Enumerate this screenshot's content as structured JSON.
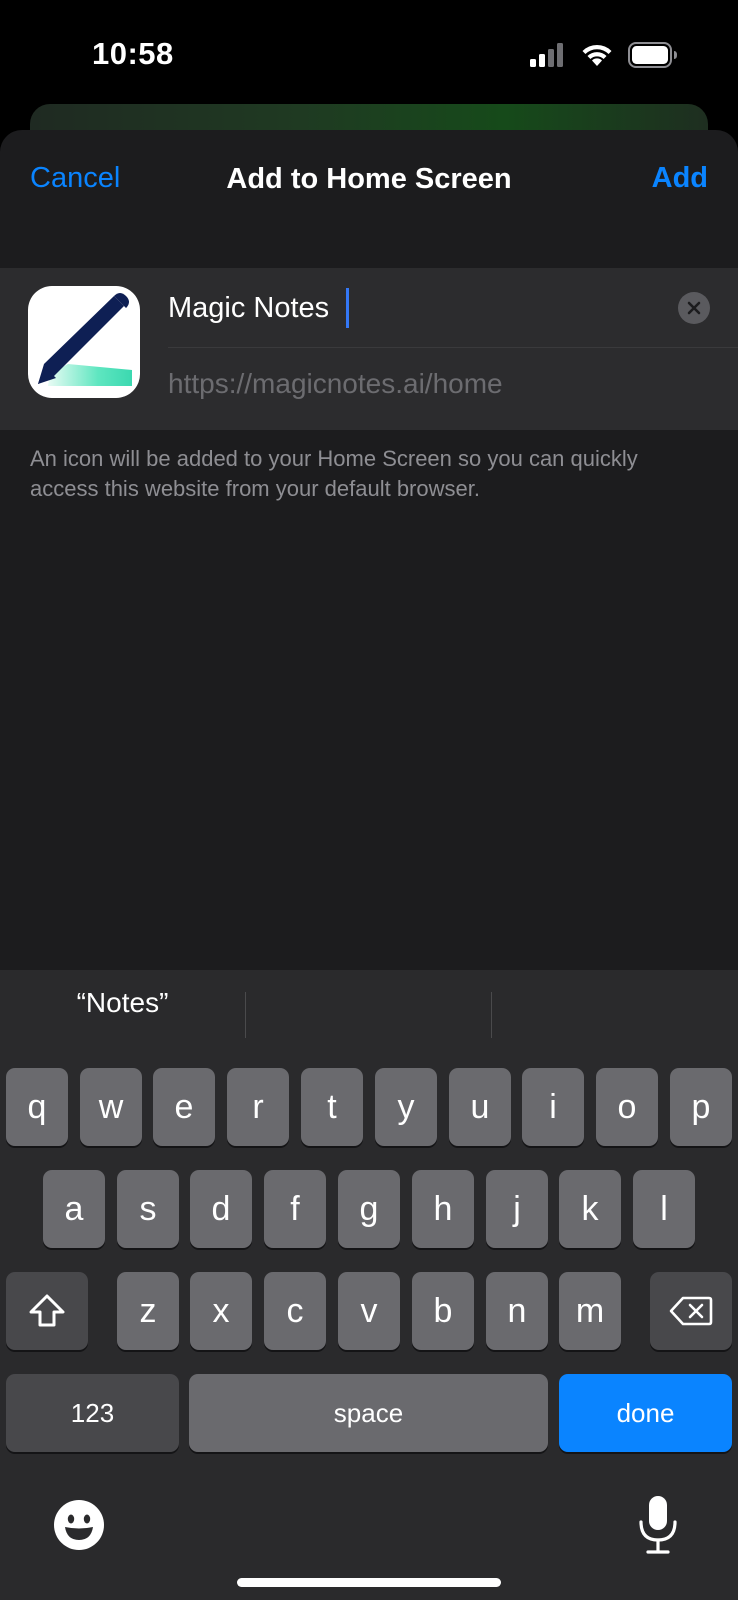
{
  "status_bar": {
    "time": "10:58"
  },
  "sheet": {
    "cancel_label": "Cancel",
    "title": "Add to Home Screen",
    "add_label": "Add",
    "name_value": "Magic Notes",
    "url": "https://magicnotes.ai/home",
    "description": "An icon will be added to your Home Screen so you can quickly access this website from your default browser."
  },
  "keyboard": {
    "suggestions": [
      "“Notes”",
      "",
      ""
    ],
    "row1": [
      "q",
      "w",
      "e",
      "r",
      "t",
      "y",
      "u",
      "i",
      "o",
      "p"
    ],
    "row2": [
      "a",
      "s",
      "d",
      "f",
      "g",
      "h",
      "j",
      "k",
      "l"
    ],
    "row3": [
      "z",
      "x",
      "c",
      "v",
      "b",
      "n",
      "m"
    ],
    "numbers_label": "123",
    "space_label": "space",
    "done_label": "done"
  },
  "colors": {
    "accent": "#0a84ff",
    "sheet_bg": "#1c1c1e",
    "group_bg": "#2c2c2e",
    "key_bg": "#6a6a6e"
  },
  "icons": [
    "cellular-signal-icon",
    "wifi-icon",
    "battery-icon",
    "clear-icon",
    "shift-icon",
    "delete-icon",
    "emoji-icon",
    "microphone-icon",
    "app-pencil-icon"
  ]
}
